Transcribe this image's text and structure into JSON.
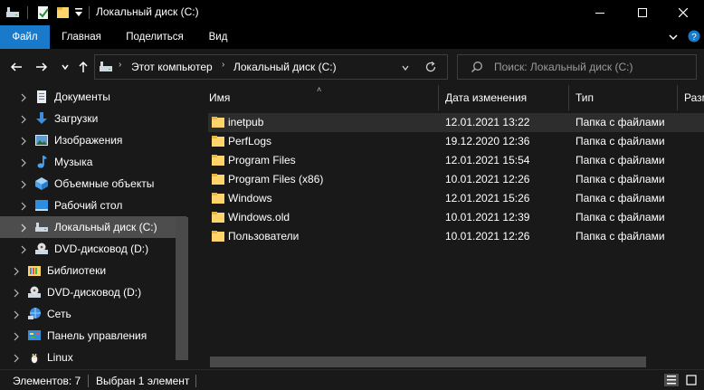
{
  "window": {
    "title": "Локальный диск (C:)",
    "accent": "#1979ca",
    "controls": [
      "minimize-icon",
      "maximize-icon",
      "close-icon"
    ]
  },
  "ribbon": {
    "tabs": [
      {
        "label": "Файл"
      },
      {
        "label": "Главная"
      },
      {
        "label": "Поделиться"
      },
      {
        "label": "Вид"
      }
    ]
  },
  "nav": {
    "breadcrumb": [
      "Этот компьютер",
      "Локальный диск (C:)"
    ],
    "search_placeholder": "Поиск: Локальный диск (C:)"
  },
  "sidebar": {
    "items": [
      {
        "label": "Документы",
        "icon": "documents-icon"
      },
      {
        "label": "Загрузки",
        "icon": "downloads-icon"
      },
      {
        "label": "Изображения",
        "icon": "pictures-icon"
      },
      {
        "label": "Музыка",
        "icon": "music-icon"
      },
      {
        "label": "Объемные объекты",
        "icon": "3d-objects-icon"
      },
      {
        "label": "Рабочий стол",
        "icon": "desktop-icon"
      },
      {
        "label": "Локальный диск (C:)",
        "icon": "drive-icon",
        "selected": true
      },
      {
        "label": "DVD-дисковод (D:)",
        "icon": "dvd-drive-icon"
      },
      {
        "label": "Библиотеки",
        "icon": "libraries-icon"
      },
      {
        "label": "DVD-дисковод (D:)",
        "icon": "dvd-drive-icon"
      },
      {
        "label": "Сеть",
        "icon": "network-icon"
      },
      {
        "label": "Панель управления",
        "icon": "control-panel-icon"
      },
      {
        "label": "Linux",
        "icon": "linux-icon"
      }
    ]
  },
  "columns": [
    "Имя",
    "Дата изменения",
    "Тип",
    "Разм"
  ],
  "files": [
    {
      "name": "inetpub",
      "date": "12.01.2021 13:22",
      "type": "Папка с файлами",
      "selected": true
    },
    {
      "name": "PerfLogs",
      "date": "19.12.2020 12:36",
      "type": "Папка с файлами"
    },
    {
      "name": "Program Files",
      "date": "12.01.2021 15:54",
      "type": "Папка с файлами"
    },
    {
      "name": "Program Files (x86)",
      "date": "10.01.2021 12:26",
      "type": "Папка с файлами"
    },
    {
      "name": "Windows",
      "date": "12.01.2021 15:26",
      "type": "Папка с файлами"
    },
    {
      "name": "Windows.old",
      "date": "10.01.2021 12:39",
      "type": "Папка с файлами"
    },
    {
      "name": "Пользователи",
      "date": "10.01.2021 12:26",
      "type": "Папка с файлами"
    }
  ],
  "status": {
    "items_count": "Элементов: 7",
    "selected": "Выбран 1 элемент"
  }
}
